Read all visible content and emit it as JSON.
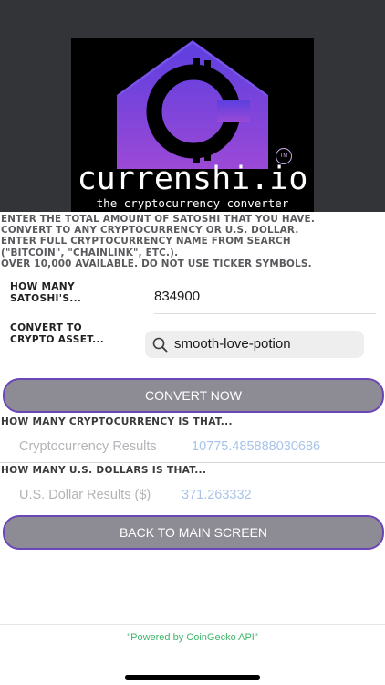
{
  "header": {
    "brand": "currenshi.io",
    "tagline": "the cryptocurrency converter",
    "tm": "TM"
  },
  "instructions": [
    "ENTER THE TOTAL AMOUNT OF SATOSHI THAT YOU HAVE.",
    "CONVERT TO ANY CRYPTOCURRENCY OR U.S. DOLLAR.",
    "ENTER FULL CRYPTOCURRENCY NAME FROM SEARCH",
    "(\"BITCOIN\", \"CHAINLINK\", ETC.).",
    "OVER 10,000 AVAILABLE. DO NOT USE TICKER SYMBOLS."
  ],
  "form": {
    "satoshi_label_1": "HOW MANY",
    "satoshi_label_2": "SATOSHI'S...",
    "satoshi_value": "834900",
    "asset_label_1": "CONVERT TO",
    "asset_label_2": "CRYPTO ASSET...",
    "asset_search_value": "smooth-love-potion",
    "search_icon": "search-icon"
  },
  "buttons": {
    "convert": "CONVERT NOW",
    "back": "BACK TO MAIN SCREEN"
  },
  "results": {
    "crypto_heading": "HOW MANY CRYPTOCURRENCY IS THAT...",
    "crypto_label": "Cryptocurrency Results",
    "crypto_value": "10775.485888030686",
    "usd_heading": "HOW MANY U.S. DOLLARS IS THAT...",
    "usd_label": "U.S. Dollar Results ($)",
    "usd_value": "371.263332"
  },
  "footer": {
    "powered_by": "\"Powered by CoinGecko API\""
  },
  "colors": {
    "header_bg": "#333438",
    "button_bg": "#8d8c94",
    "button_border": "#6b46b6",
    "result_value": "#a9c4ea",
    "footer_text": "#3fb66b"
  }
}
